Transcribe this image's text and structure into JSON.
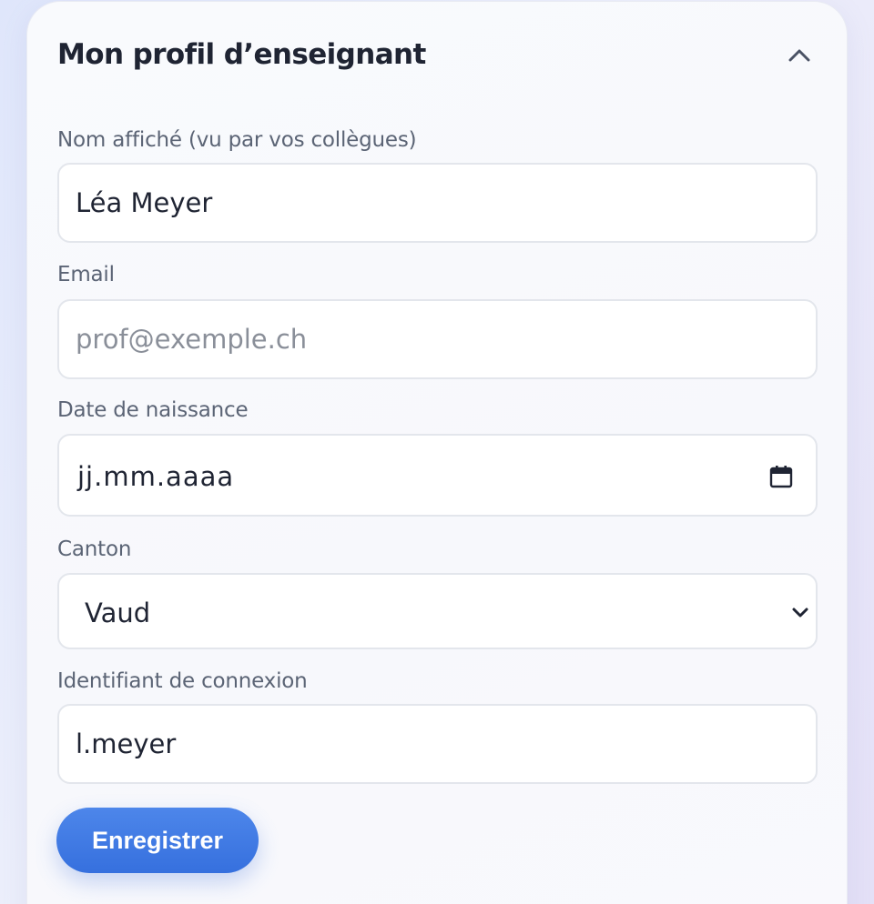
{
  "profile": {
    "title": "Mon profil d’enseignant",
    "fields": {
      "display_name": {
        "label": "Nom affiché (vu par vos collègues)",
        "value": "Léa Meyer"
      },
      "email": {
        "label": "Email",
        "value": "",
        "placeholder": "prof@exemple.ch"
      },
      "birthdate": {
        "label": "Date de naissance",
        "placeholder": "jj.mm.aaaa"
      },
      "canton": {
        "label": "Canton",
        "selected": "Vaud"
      },
      "login": {
        "label": "Identifiant de connexion",
        "value": "l.meyer"
      }
    },
    "save_label": "Enregistrer"
  },
  "colors": {
    "accent": "#3b77e2",
    "text": "#1f2433",
    "label": "#5b6475"
  },
  "icons": [
    "chevron-up-icon",
    "calendar-icon",
    "chevron-down-icon"
  ]
}
